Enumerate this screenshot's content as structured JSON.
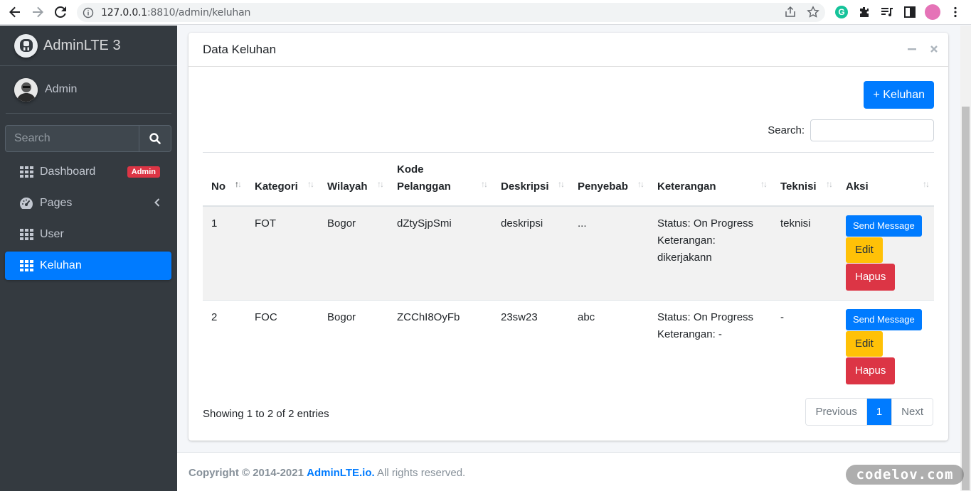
{
  "browser": {
    "url_host": "127.0.0.1",
    "url_rest": ":8810/admin/keluhan"
  },
  "sidebar": {
    "brand": "AdminLTE 3",
    "user": "Admin",
    "search_placeholder": "Search",
    "items": [
      {
        "label": "Dashboard",
        "badge": "Admin"
      },
      {
        "label": "Pages"
      },
      {
        "label": "User"
      },
      {
        "label": "Keluhan"
      }
    ]
  },
  "card": {
    "title": "Data Keluhan",
    "add_button": "+ Keluhan",
    "search_label": "Search:"
  },
  "table": {
    "headers": [
      "No",
      "Kategori",
      "Wilayah",
      "Kode Pelanggan",
      "Deskripsi",
      "Penyebab",
      "Keterangan",
      "Teknisi",
      "Aksi"
    ],
    "rows": [
      {
        "no": "1",
        "kategori": "FOT",
        "wilayah": "Bogor",
        "kode": "dZtySjpSmi",
        "deskripsi": "deskripsi",
        "penyebab": "...",
        "status": "Status: On Progress",
        "keterangan": "Keterangan: dikerjakann",
        "teknisi": "teknisi"
      },
      {
        "no": "2",
        "kategori": "FOC",
        "wilayah": "Bogor",
        "kode": "ZCChI8OyFb",
        "deskripsi": "23sw23",
        "penyebab": "abc",
        "status": "Status: On Progress",
        "keterangan": "Keterangan: -",
        "teknisi": "-"
      }
    ],
    "actions": {
      "message": "Send Message",
      "edit": "Edit",
      "delete": "Hapus"
    }
  },
  "info": "Showing 1 to 2 of 2 entries",
  "pagination": {
    "prev": "Previous",
    "page": "1",
    "next": "Next"
  },
  "footer": {
    "copyright": "Copyright © 2014-2021",
    "link": "AdminLTE.io.",
    "rights": "All rights reserved."
  },
  "watermark": "codelov.com"
}
